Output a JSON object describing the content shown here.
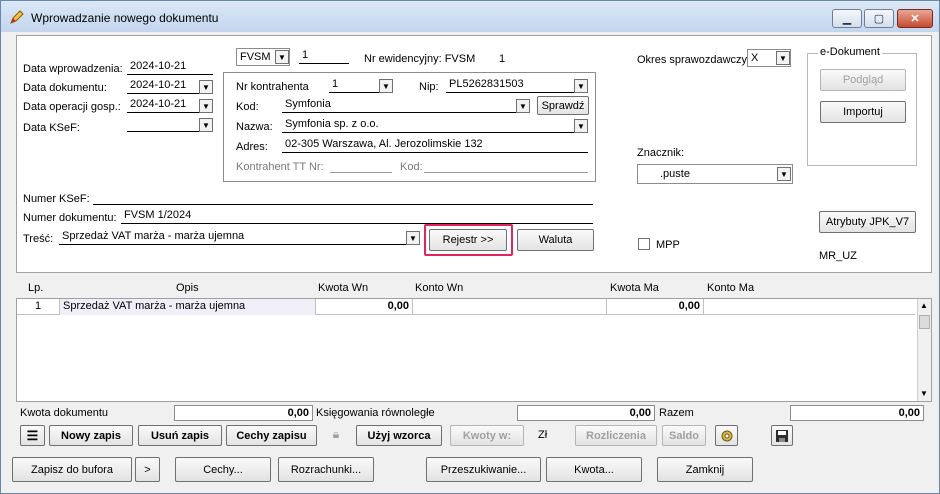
{
  "window": {
    "title": "Wprowadzanie nowego dokumentu",
    "minimize": "▁",
    "maximize": "▢",
    "close": "✕"
  },
  "header": {
    "data_wprowadzenia_label": "Data wprowadzenia:",
    "data_wprowadzenia_value": "2024-10-21",
    "data_dokumentu_label": "Data dokumentu:",
    "data_dokumentu_value": "2024-10-21",
    "data_operacji_label": "Data operacji gosp.:",
    "data_operacji_value": "2024-10-21",
    "data_ksef_label": "Data KSeF:",
    "data_ksef_value": "",
    "rejestr_value": "FVSM",
    "rejestr_number": "1",
    "nr_ewid_label": "Nr ewidencyjny: FVSM",
    "nr_ewid_value": "1",
    "okres_label": "Okres sprawozdawczy:",
    "okres_value": "X"
  },
  "contractor": {
    "nr_label": "Nr kontrahenta",
    "nr_value": "1",
    "nip_label": "Nip:",
    "nip_value": "PL5262831503",
    "kod_label": "Kod:",
    "kod_value": "Symfonia",
    "sprawdz_label": "Sprawdź",
    "nazwa_label": "Nazwa:",
    "nazwa_value": "Symfonia sp. z o.o.",
    "adres_label": "Adres:",
    "adres_value": "02-305 Warszawa, Al. Jerozolimskie 132",
    "tt_label": "Kontrahent TT Nr:",
    "tt_kod_label": "Kod:"
  },
  "edokument": {
    "title": "e-Dokument",
    "podglad": "Podgląd",
    "importuj": "Importuj"
  },
  "znacznik": {
    "label": "Znacznik:",
    "value": ".puste"
  },
  "document": {
    "numer_ksef_label": "Numer KSeF:",
    "numer_ksef_value": "",
    "numer_dok_label": "Numer dokumentu:",
    "numer_dok_value": "FVSM 1/2024",
    "tresc_label": "Treść:",
    "tresc_value": "Sprzedaż VAT marża - marża ujemna",
    "rejestr_button": "Rejestr >>",
    "waluta_button": "Waluta",
    "mpp_label": "MPP",
    "atrybuty_button": "Atrybuty JPK_V7",
    "mr_uz": "MR_UZ"
  },
  "table": {
    "headers": [
      "Lp.",
      "Opis",
      "Kwota Wn",
      "Konto Wn",
      "Kwota Ma",
      "Konto Ma"
    ],
    "rows": [
      {
        "lp": "1",
        "opis": "Sprzedaż VAT marża - marża ujemna",
        "kwota_wn": "0,00",
        "konto_wn": "",
        "kwota_ma": "0,00",
        "konto_ma": ""
      }
    ]
  },
  "totals": {
    "kwota_dok_label": "Kwota dokumentu",
    "kwota_dok_value": "0,00",
    "ksieg_label": "Księgowania równoległe",
    "ksieg_value": "0,00",
    "razem_label": "Razem",
    "razem_value": "0,00"
  },
  "toolbar": {
    "nowy_zapis": "Nowy zapis",
    "usun_zapis": "Usuń zapis",
    "cechy_zapisu": "Cechy zapisu",
    "uzyj_wzorca": "Użyj wzorca",
    "kwoty_w": "Kwoty w:",
    "currency": "Zł",
    "rozliczenia": "Rozliczenia",
    "saldo": "Saldo"
  },
  "bottom": {
    "zapisz": "Zapisz do bufora",
    "more": ">",
    "cechy": "Cechy...",
    "rozrachunki": "Rozrachunki...",
    "przeszukiwanie": "Przeszukiwanie...",
    "kwota": "Kwota...",
    "zamknij": "Zamknij"
  }
}
